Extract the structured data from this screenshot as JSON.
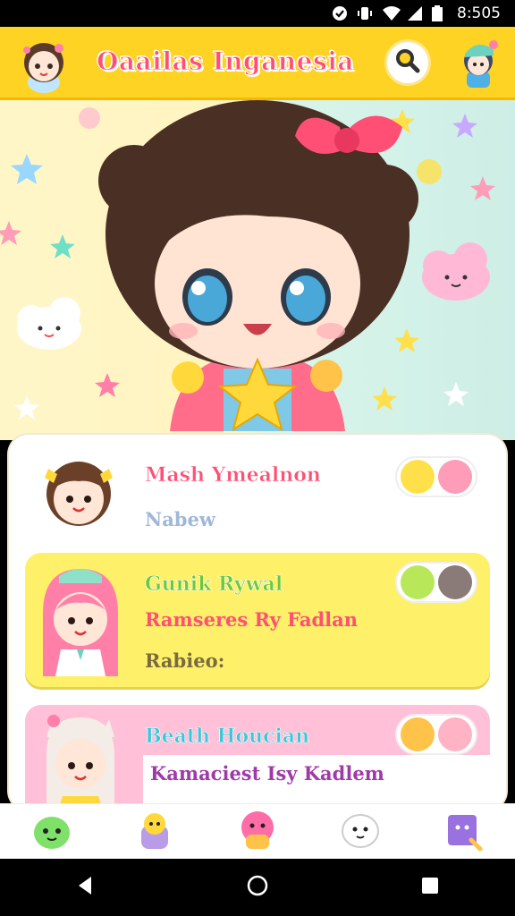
{
  "status_bar": {
    "time": "8:505"
  },
  "header": {
    "title": "Oaailas Inganesia"
  },
  "list": {
    "items": [
      {
        "name": "Mash Ymealnon",
        "subtitle": "Nabew",
        "subtitle2": ""
      },
      {
        "name": "Gunik Rywal",
        "subtitle": "Ramseres Ry Fadlan",
        "subtitle2": "Rabieo:"
      },
      {
        "name": "Beath Houcian",
        "subtitle": "Kamaciest Isy Kadlem",
        "subtitle2": ""
      }
    ]
  },
  "colors": {
    "header_bg": "#ffd323",
    "title": "#ff4f74",
    "card2_bg": "#fff06a",
    "card3_bg": "#ffc0d8"
  }
}
